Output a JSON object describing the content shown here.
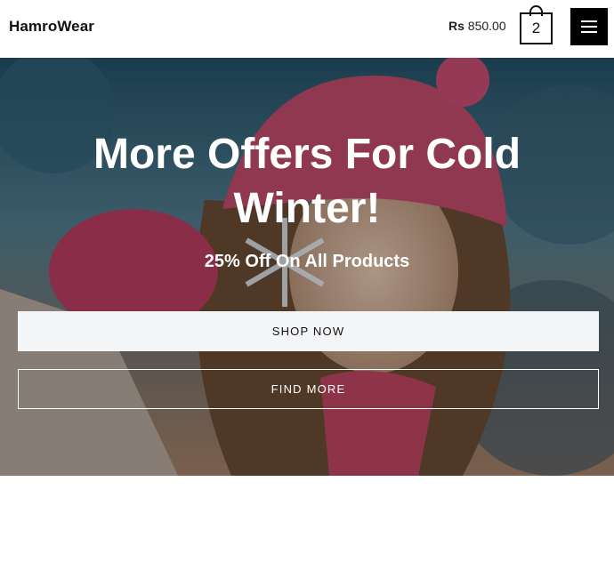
{
  "header": {
    "logo": "HamroWear",
    "price_currency": "Rs",
    "price_amount": "850.00",
    "cart_count": "2",
    "cart_icon": "shopping-bag-icon",
    "menu_icon": "hamburger-menu-icon"
  },
  "hero": {
    "title": "More Offers For Cold Winter!",
    "subtitle": "25% Off On All Products",
    "shop_label": "SHOP NOW",
    "find_label": "FIND MORE"
  },
  "colors": {
    "header_bg": "#ffffff",
    "menu_button_bg": "#000000",
    "shop_button_bg": "#f4f5f7",
    "hero_text": "#ffffff"
  }
}
